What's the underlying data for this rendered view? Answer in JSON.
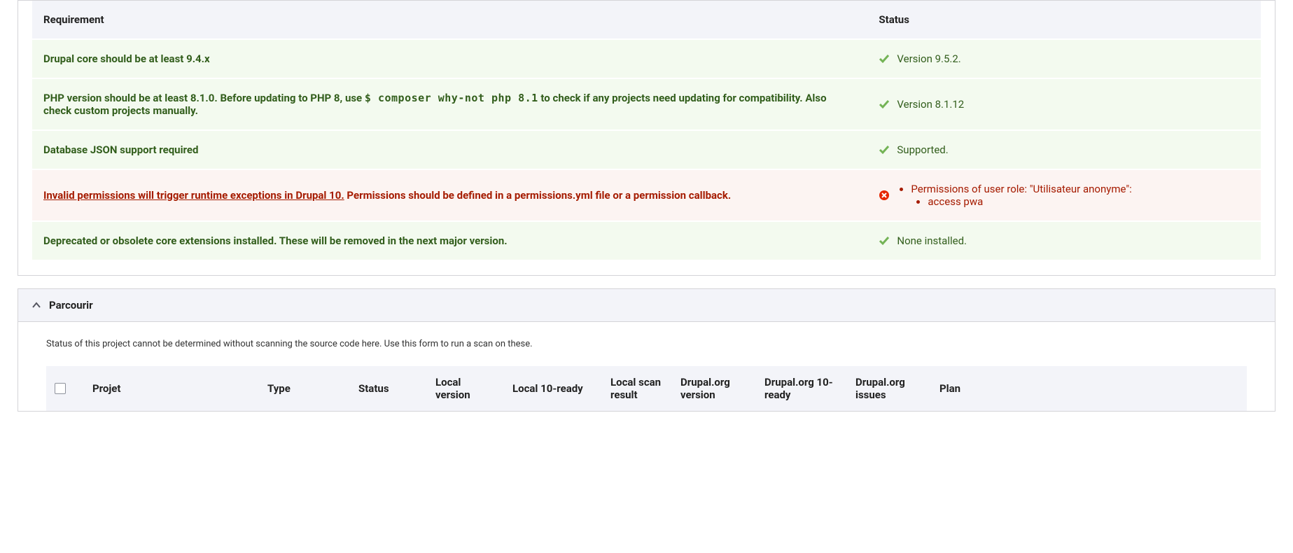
{
  "req_table": {
    "headers": {
      "req": "Requirement",
      "status": "Status"
    },
    "rows": {
      "core": {
        "label": "Drupal core should be at least 9.4.x",
        "status": "Version 9.5.2."
      },
      "php": {
        "prefix": "PHP version should be at least 8.1.0. Before updating to PHP 8, use ",
        "code": "$ composer why-not php 8.1",
        "suffix": " to check if any projects need updating for compatibility. Also check custom projects manually.",
        "status": "Version 8.1.12"
      },
      "json": {
        "label": "Database JSON support required",
        "status": "Supported."
      },
      "perms": {
        "link": "Invalid permissions will trigger runtime exceptions in Drupal 10.",
        "rest": " Permissions should be defined in a permissions.yml file or a permission callback.",
        "status_item": "Permissions of user role: \"Utilisateur anonyme\":",
        "status_sub": "access pwa"
      },
      "dep": {
        "label": "Deprecated or obsolete core extensions installed. These will be removed in the next major version.",
        "status": "None installed."
      }
    }
  },
  "parcourir": {
    "title": "Parcourir",
    "help": "Status of this project cannot be determined without scanning the source code here. Use this form to run a scan on these.",
    "headers": {
      "projet": "Projet",
      "type": "Type",
      "status": "Status",
      "localv": "Local version",
      "local10": "Local 10-ready",
      "localscan": "Local scan result",
      "dov": "Drupal.org version",
      "do10": "Drupal.org 10-ready",
      "doi": "Drupal.org issues",
      "plan": "Plan"
    }
  }
}
